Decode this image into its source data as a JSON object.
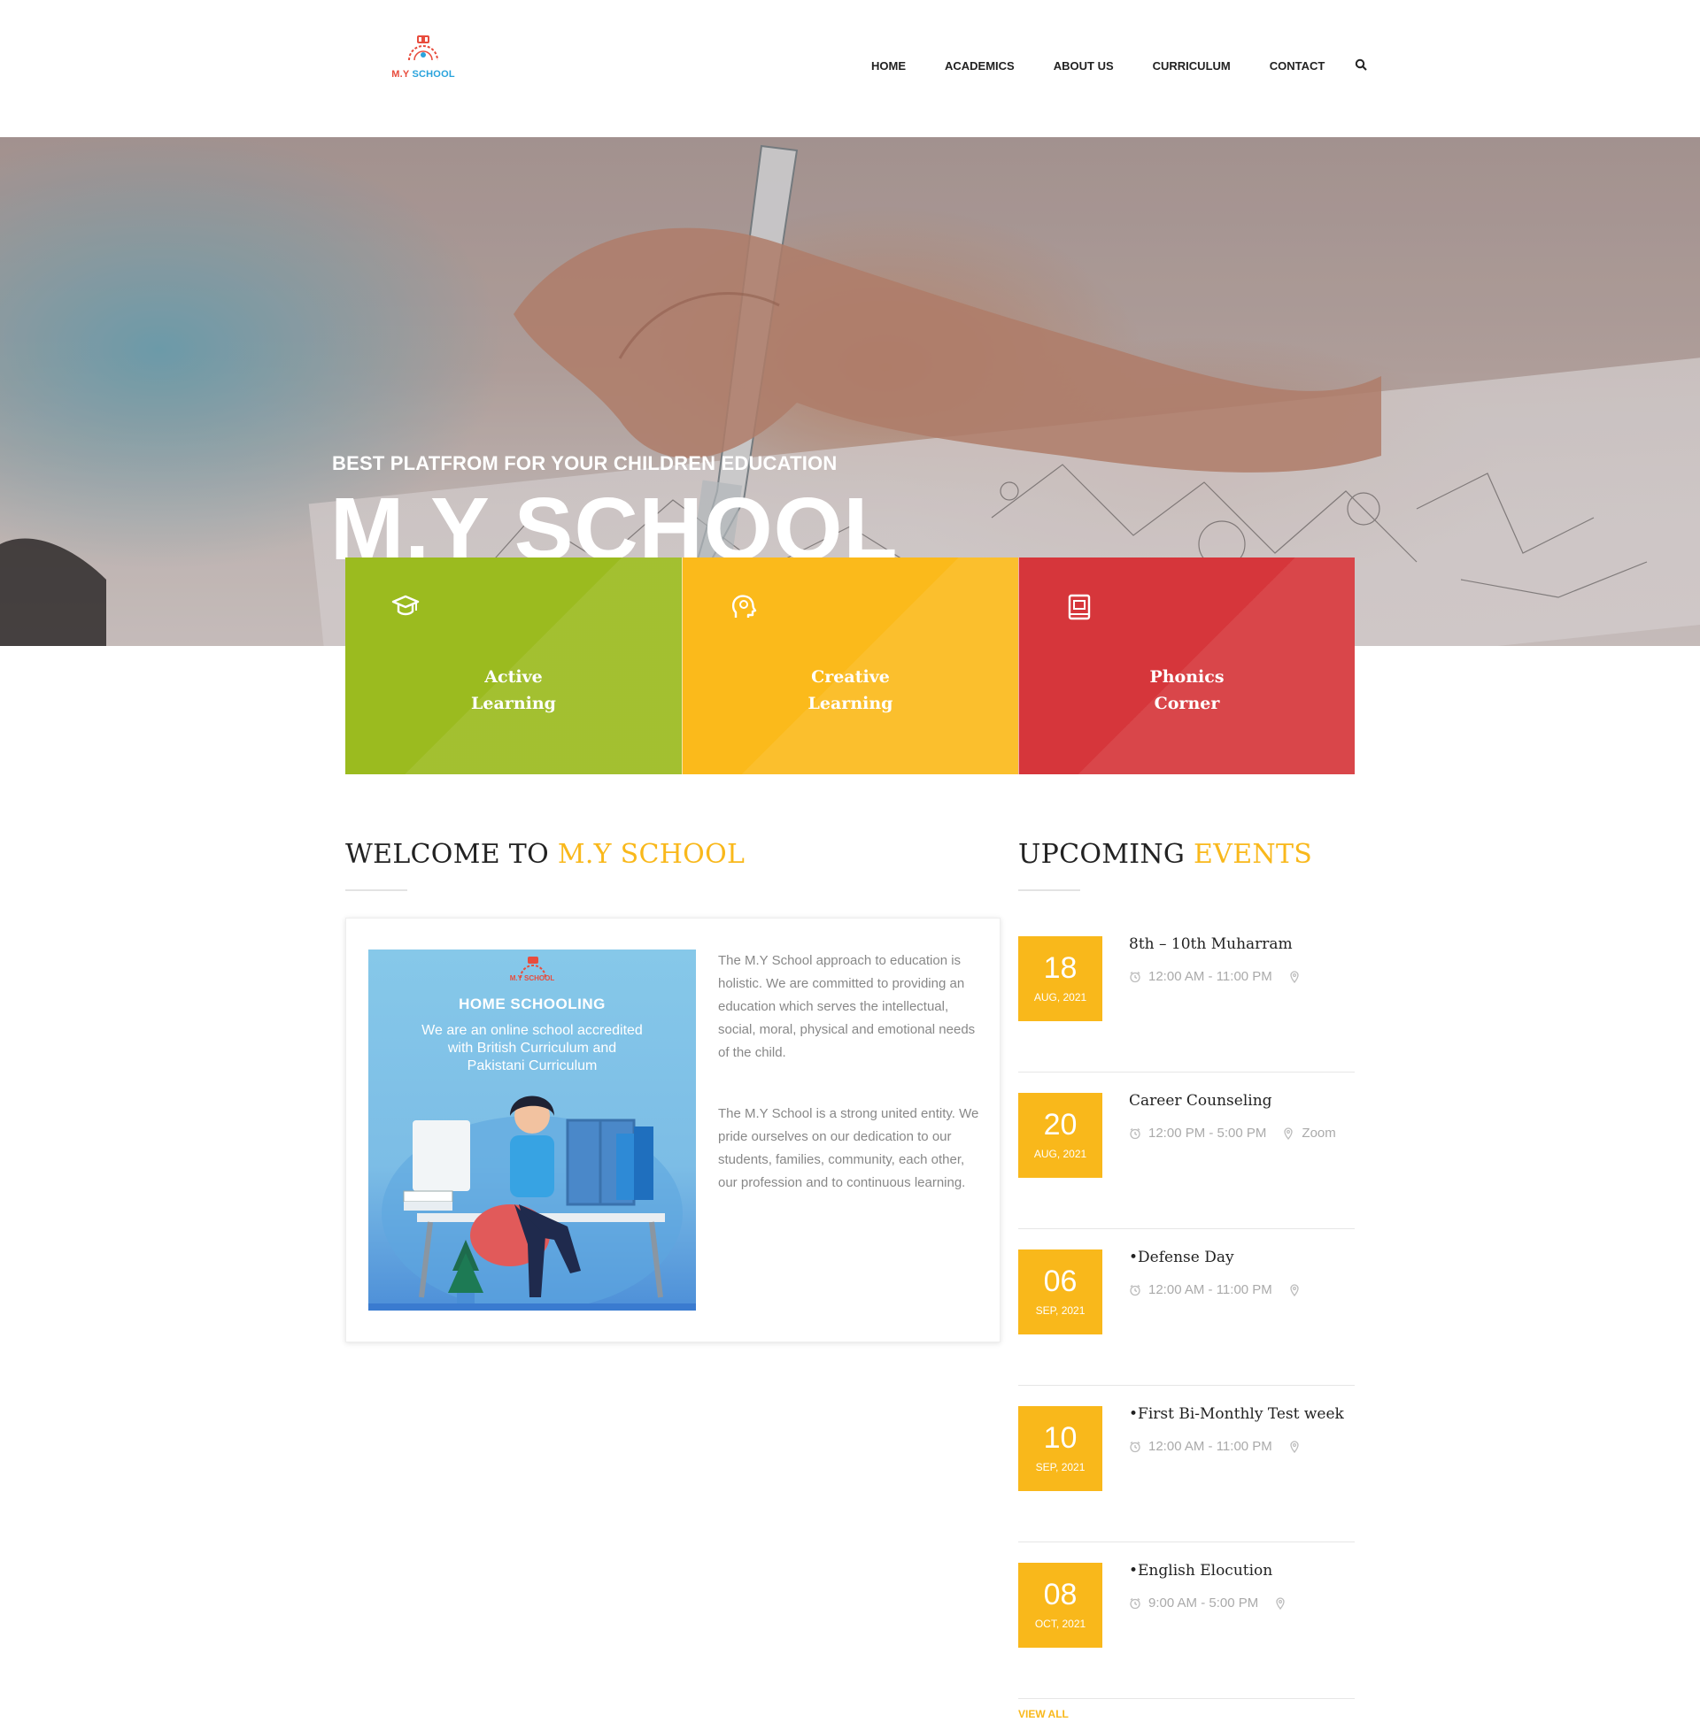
{
  "brand": {
    "logo_my": "M.Y",
    "logo_school": "SCHOOL"
  },
  "nav": {
    "items": [
      {
        "label": "HOME"
      },
      {
        "label": "ACADEMICS"
      },
      {
        "label": "ABOUT US"
      },
      {
        "label": "CURRICULUM"
      },
      {
        "label": "CONTACT"
      }
    ],
    "search_icon": "search-icon"
  },
  "hero": {
    "subtitle": "BEST PLATFROM FOR YOUR CHILDREN EDUCATION",
    "title": "M.Y SCHOOL"
  },
  "features": [
    {
      "line1": "Active",
      "line2": "Learning",
      "icon": "graduation-cap-icon",
      "color": "#9bbb1f"
    },
    {
      "line1": "Creative",
      "line2": "Learning",
      "icon": "creative-head-icon",
      "color": "#fbba1b"
    },
    {
      "line1": "Phonics",
      "line2": "Corner",
      "icon": "book-icon",
      "color": "#d6363b"
    }
  ],
  "welcome": {
    "title_main": "WELCOME TO",
    "title_accent": "M.Y SCHOOL",
    "image": {
      "logo_text": "M.Y SCHOOL",
      "heading": "HOME SCHOOLING",
      "line1": "We are an online school accredited",
      "line2": "with British Curriculum and",
      "line3": "Pakistani Curriculum"
    },
    "para1": "The M.Y School approach to education is holistic. We are committed to providing an education which serves the intellectual, social, moral, physical and emotional needs of the child.",
    "para2": "The M.Y School is a strong united entity. We pride ourselves on our dedication to our students, families, community, each other, our profession and to continuous learning."
  },
  "events": {
    "title_main": "UPCOMING",
    "title_accent": "EVENTS",
    "items": [
      {
        "day": "18",
        "month": "AUG, 2021",
        "title": "8th – 10th Muharram",
        "time": "12:00 AM - 11:00 PM",
        "location": ""
      },
      {
        "day": "20",
        "month": "AUG, 2021",
        "title": "Career Counseling",
        "time": "12:00 PM - 5:00 PM",
        "location": "Zoom"
      },
      {
        "day": "06",
        "month": "SEP, 2021",
        "title": "•Defense Day",
        "time": "12:00 AM - 11:00 PM",
        "location": ""
      },
      {
        "day": "10",
        "month": "SEP, 2021",
        "title": "•First Bi-Monthly Test week",
        "time": "12:00 AM - 11:00 PM",
        "location": ""
      },
      {
        "day": "08",
        "month": "OCT, 2021",
        "title": "•English Elocution",
        "time": "9:00 AM - 5:00 PM",
        "location": ""
      }
    ],
    "view_all": "VIEW ALL"
  },
  "colors": {
    "accent": "#f9b81b",
    "green": "#9bbb1f",
    "yellow": "#fbba1b",
    "red": "#d6363b"
  }
}
